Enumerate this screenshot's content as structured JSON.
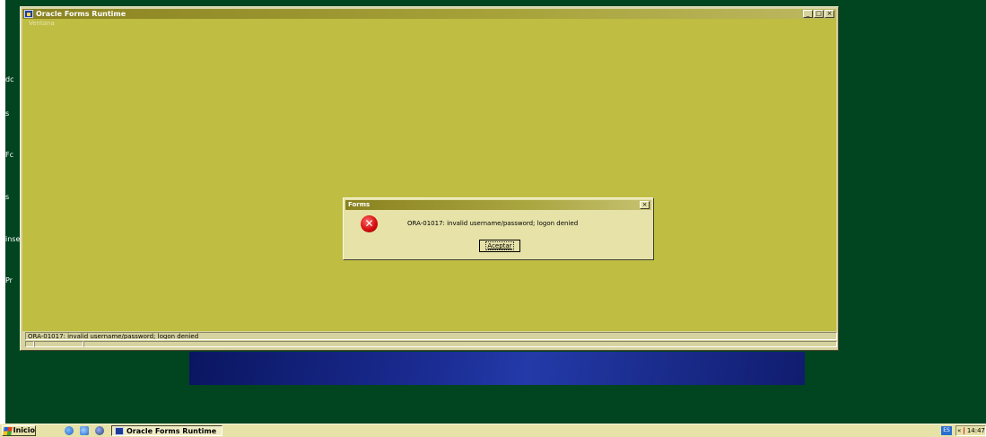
{
  "desktop": {
    "labels": [
      "dc",
      "s",
      "Fc",
      "s",
      "inse",
      "Pr"
    ],
    "color": "#004420"
  },
  "main_window": {
    "title": "Oracle Forms Runtime",
    "menu": [
      "Ventana"
    ],
    "controls": {
      "minimize": "_",
      "maximize": "□",
      "close": "×"
    },
    "status_message": "ORA-01017: invalid username/password; logon denied",
    "client_color": "#bfbd42"
  },
  "dialog": {
    "title": "Forms",
    "close_label": "×",
    "message": "ORA-01017: invalid username/password; logon denied",
    "button_label": "Aceptar",
    "icon": "error-icon"
  },
  "taskbar": {
    "start_label": "Inicio",
    "task_label": "Oracle Forms Runtime",
    "language": "ES",
    "tray_expand": "«",
    "clock": "14:47"
  }
}
